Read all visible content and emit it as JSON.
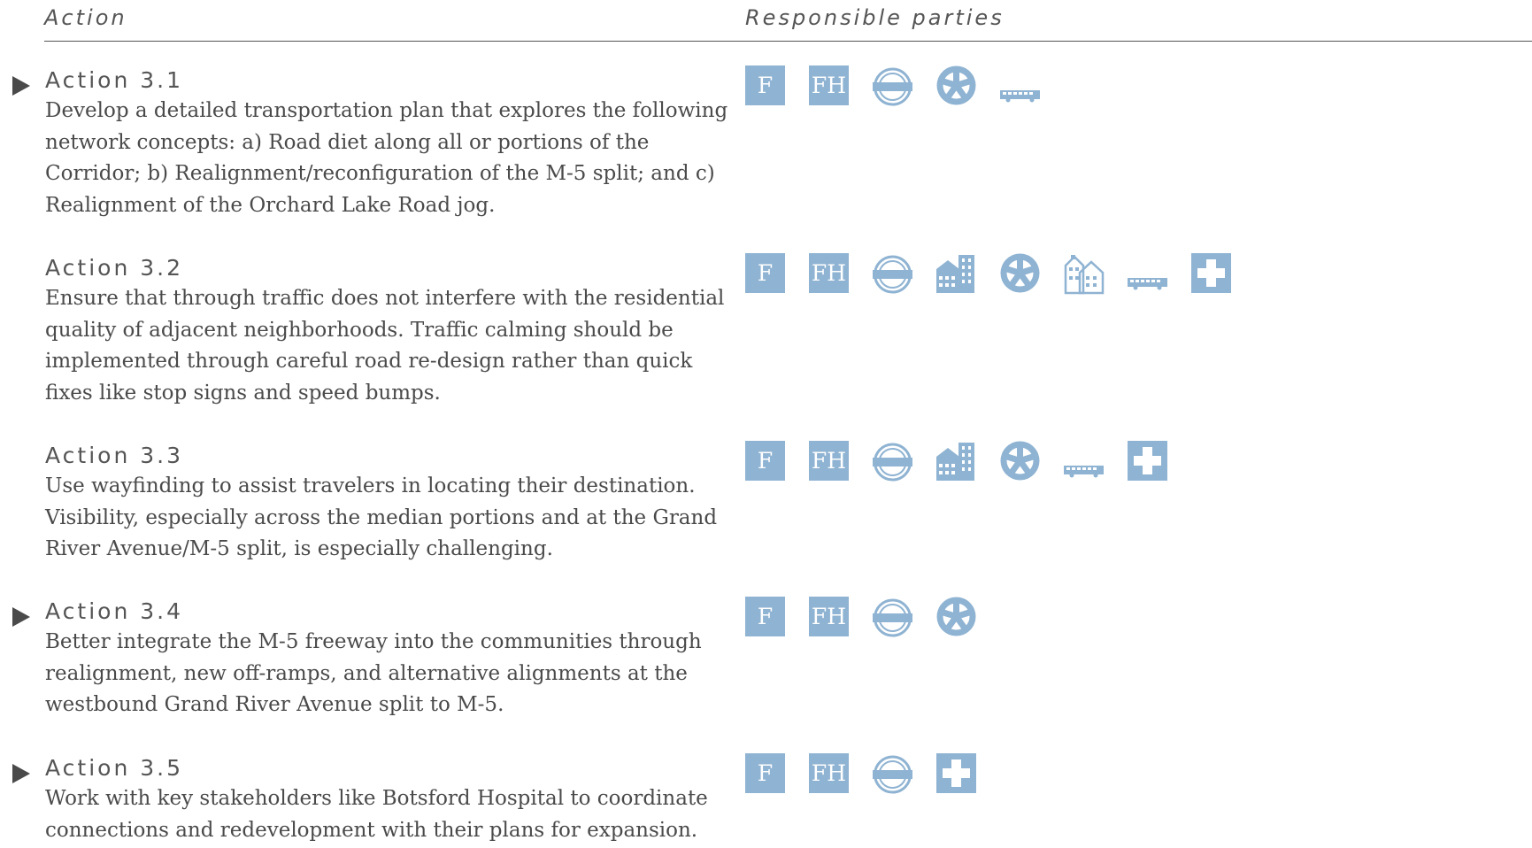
{
  "header": {
    "action": "Action",
    "parties": "Responsible parties"
  },
  "colors": {
    "icon": "#8fb3d2",
    "text": "#4a4a4a"
  },
  "actions": [
    {
      "title": "Action 3.1",
      "marked": true,
      "description": "Develop a detailed transportation plan that explores the following network concepts:  a)  Road diet along all or portions of the Corridor; b)  Realignment/reconfiguration of the M-5 split; and c) Realignment of the Orchard Lake Road jog.",
      "icons": [
        "F",
        "FH",
        "road-agency-icon",
        "wheel-icon",
        "bus-icon"
      ]
    },
    {
      "title": "Action 3.2",
      "marked": false,
      "description": "Ensure that through traffic does not interfere with the residential quality of adjacent neighborhoods.  Traffic calming should be implemented through careful road re-design rather than quick fixes like stop signs and speed bumps.",
      "icons": [
        "F",
        "FH",
        "road-agency-icon",
        "city-building-icon",
        "wheel-icon",
        "residential-icon",
        "bus-icon",
        "hospital-cross-icon"
      ]
    },
    {
      "title": "Action 3.3",
      "marked": false,
      "description": "Use wayfinding to assist travelers in locating their destination. Visibility, especially across the median portions and at the Grand River Avenue/M-5 split, is especially challenging.",
      "icons": [
        "F",
        "FH",
        "road-agency-icon",
        "city-building-icon",
        "wheel-icon",
        "bus-icon",
        "hospital-cross-icon"
      ]
    },
    {
      "title": "Action 3.4",
      "marked": true,
      "description": "Better integrate the M-5 freeway into the communities through realignment, new off-ramps, and alternative alignments at the westbound Grand River Avenue split to M-5.",
      "icons": [
        "F",
        "FH",
        "road-agency-icon",
        "wheel-icon"
      ]
    },
    {
      "title": "Action 3.5",
      "marked": true,
      "description": "Work with key stakeholders like Botsford Hospital to coordinate connections and redevelopment with their plans for expansion.",
      "icons": [
        "F",
        "FH",
        "road-agency-icon",
        "hospital-cross-icon"
      ]
    }
  ]
}
